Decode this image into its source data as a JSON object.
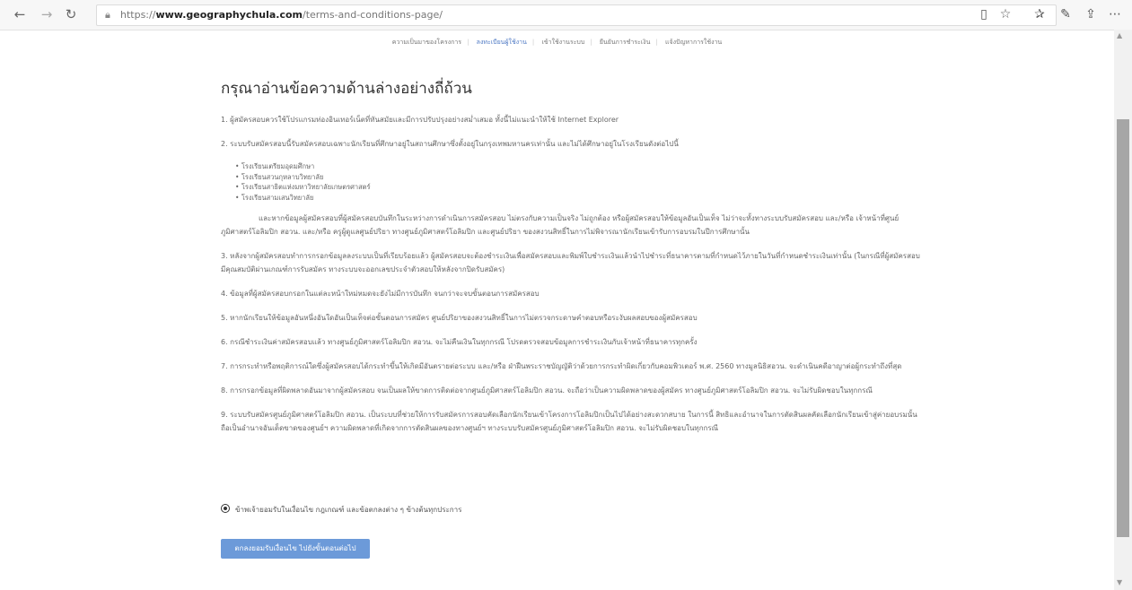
{
  "browser": {
    "url_prefix": "https://",
    "url_domain": "www.geographychula.com",
    "url_path": "/terms-and-conditions-page/",
    "icons": {
      "back": "arrow-left-icon",
      "forward": "arrow-right-icon",
      "refresh": "refresh-icon",
      "lock": "lock-icon",
      "reading_view": "book-icon",
      "favorite": "star-icon",
      "favorites_list": "star-list-icon",
      "notes": "pen-icon",
      "share": "share-icon",
      "more": "more-icon"
    }
  },
  "steps": [
    {
      "label": "ความเป็นมาของโครงการ",
      "active": false
    },
    {
      "label": "ลงทะเบียนผู้ใช้งาน",
      "active": true
    },
    {
      "label": "เข้าใช้งานระบบ",
      "active": false
    },
    {
      "label": "ยืนยันการชำระเงิน",
      "active": false
    },
    {
      "label": "แจ้งปัญหาการใช้งาน",
      "active": false
    }
  ],
  "page": {
    "heading": "กรุณาอ่านข้อความด้านล่างอย่างถี่ถ้วน",
    "p1": "1. ผู้สมัครสอบควรใช้โปรแกรมท่องอินเทอร์เน็ตที่ทันสมัยและมีการปรับปรุงอย่างสม่ำเสมอ ทั้งนี้ไม่แนะนำให้ใช้ Internet Explorer",
    "p2": "2. ระบบรับสมัครสอบนี้รับสมัครสอบเฉพาะนักเรียนที่ศึกษาอยู่ในสถานศึกษาซึ่งตั้งอยู่ในกรุงเทพมหานครเท่านั้น และไม่ได้ศึกษาอยู่ในโรงเรียนดังต่อไปนี้",
    "schools": [
      "โรงเรียนเตรียมอุดมศึกษา",
      "โรงเรียนสวนกุหลาบวิทยาลัย",
      "โรงเรียนสาธิตแห่งมหาวิทยาลัยเกษตรศาสตร์",
      "โรงเรียนสามเสนวิทยาลัย"
    ],
    "p2_note": "และหากข้อมูลผู้สมัครสอบที่ผู้สมัครสอบบันทึกในระหว่างการดำเนินการสมัครสอบ ไม่ตรงกับความเป็นจริง ไม่ถูกต้อง หรือผู้สมัครสอบให้ข้อมูลอันเป็นเท็จ ไม่ว่าจะทั้งทางระบบรับสมัครสอบ และ/หรือ เจ้าหน้าที่ศูนย์ภูมิศาสตร์โอลิมปิก สอวน. และ/หรือ ครูผู้ดูแลศูนย์ปริยา ทางศูนย์ภูมิศาสตร์โอลิมปิก และศูนย์ปริยา ของสงวนสิทธิ์ในการไม่พิจารณานักเรียนเข้ารับการอบรมในปีการศึกษานั้น",
    "p3": "3. หลังจากผู้สมัครสอบทำการกรอกข้อมูลลงระบบเป็นที่เรียบร้อยแล้ว ผู้สมัครสอบจะต้องชำระเงินเพื่อสมัครสอบและพิมพ์ใบชำระเงินแล้วนำไปชำระที่ธนาคารตามที่กำหนดไว้ภายในวันที่กำหนดชำระเงินเท่านั้น (ในกรณีที่ผู้สมัครสอบมีคุณสมบัติผ่านเกณฑ์การรับสมัคร ทางระบบจะออกเลขประจำตัวสอบให้หลังจากปิดรับสมัคร)",
    "p4": "4. ข้อมูลที่ผู้สมัครสอบกรอกในแต่ละหน้าใหม่หมดจะยังไม่มีการบันทึก จนกว่าจะจบขั้นตอนการสมัครสอบ",
    "p5": "5. หากนักเรียนให้ข้อมูลอันหนึ่งอันใดอันเป็นเท็จต่อขั้นตอนการสมัคร ศูนย์ปริยาของสงวนสิทธิ์ในการไม่ตรวจกระดาษคำตอบหรือระงับผลสอบของผู้สมัครสอบ",
    "p6": "6. กรณีชำระเงินค่าสมัครสอบแล้ว ทางศูนย์ภูมิศาสตร์โอลิมปิก สอวน. จะไม่คืนเงินในทุกกรณี โปรดตรวจสอบข้อมูลการชำระเงินกับเจ้าหน้าที่ธนาคารทุกครั้ง",
    "p7": "7. การกระทำหรือพฤติการณ์ใดซึ่งผู้สมัครสอบได้กระทำขึ้นให้เกิดมีอันตรายต่อระบบ และ/หรือ ฝ่าฝืนพระราชบัญญัติว่าด้วยการกระทำผิดเกี่ยวกับคอมพิวเตอร์ พ.ศ. 2560 ทางมูลนิธิสอวน. จะดำเนินคดีอาญาต่อผู้กระทำถึงที่สุด",
    "p8": "8. การกรอกข้อมูลที่ผิดพลาดอันมาจากผู้สมัครสอบ จนเป็นผลให้ขาดการติดต่อจากศูนย์ภูมิศาสตร์โอลิมปิก สอวน. จะถือว่าเป็นความผิดพลาดของผู้สมัคร ทางศูนย์ภูมิศาสตร์โอลิมปิก สอวน. จะไม่รับผิดชอบในทุกกรณี",
    "p9": "9. ระบบรับสมัครศูนย์ภูมิศาสตร์โอลิมปิก สอวน. เป็นระบบที่ช่วยให้การรับสมัครการสอบคัดเลือกนักเรียนเข้าโครงการโอลิมปิกเป็นไปได้อย่างสะดวกสบาย ในการนี้ สิทธิและอำนาจในการตัดสินผลคัดเลือกนักเรียนเข้าสู่ค่ายอบรมนั้นถือเป็นอำนาจอันเด็ดขาดของศูนย์ฯ ความผิดพลาดที่เกิดจากการตัดสินผลของทางศูนย์ฯ ทางระบบรับสมัครศูนย์ภูมิศาสตร์โอลิมปิก สอวน. จะไม่รับผิดชอบในทุกกรณี",
    "agree_label": "ข้าพเจ้ายอมรับในเงื่อนไข กฎเกณฑ์ และข้อตกลงต่าง ๆ ข้างต้นทุกประการ",
    "agree_checked": true,
    "submit_label": "ตกลงยอมรับเงื่อนไข ไปยังขั้นตอนต่อไป"
  },
  "colors": {
    "accent": "#6c9ad9",
    "active_step": "#4e79c4"
  }
}
